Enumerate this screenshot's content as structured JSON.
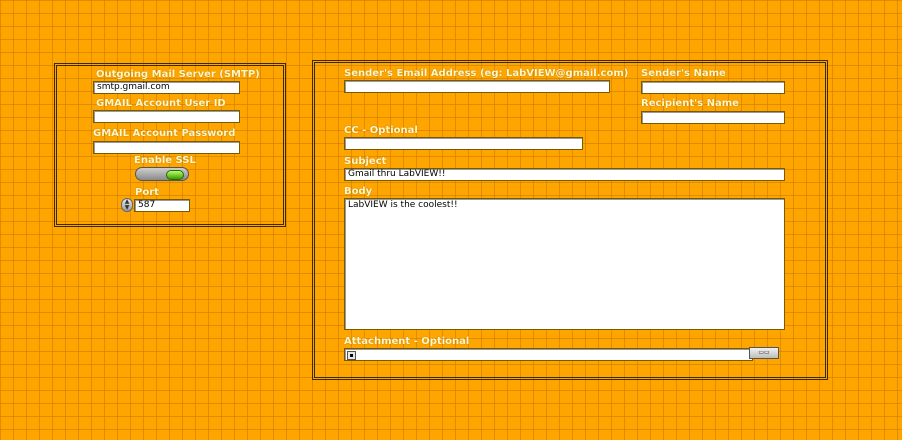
{
  "smtp_panel": {
    "server_label": "Outgoing Mail Server (SMTP)",
    "server_value": "smtp.gmail.com",
    "user_label": "GMAIL Account User ID",
    "user_value": "",
    "password_label": "GMAIL Account Password",
    "password_value": "",
    "ssl_label": "Enable SSL",
    "ssl_enabled": true,
    "port_label": "Port",
    "port_value": "587"
  },
  "message_panel": {
    "sender_email_label": "Sender's Email Address (eg: LabVIEW@gmail.com)",
    "sender_email_value": "",
    "sender_name_label": "Sender's Name",
    "sender_name_value": "",
    "recipient_name_label": "Recipient's Name",
    "recipient_name_value": "",
    "cc_label": "CC - Optional",
    "cc_value": "",
    "subject_label": "Subject",
    "subject_value": "Gmail thru LabVIEW!!",
    "body_label": "Body",
    "body_value": "LabVIEW is the coolest!!",
    "attachment_label": "Attachment - Optional",
    "attachment_value": "",
    "browse_icon": "browse-folder-icon",
    "path_icon": "path-icon"
  },
  "colors": {
    "background": "#ffa500",
    "grid": "#c87800",
    "label_text": "#fff8c8",
    "ssl_led_on": "#3c9a00"
  }
}
